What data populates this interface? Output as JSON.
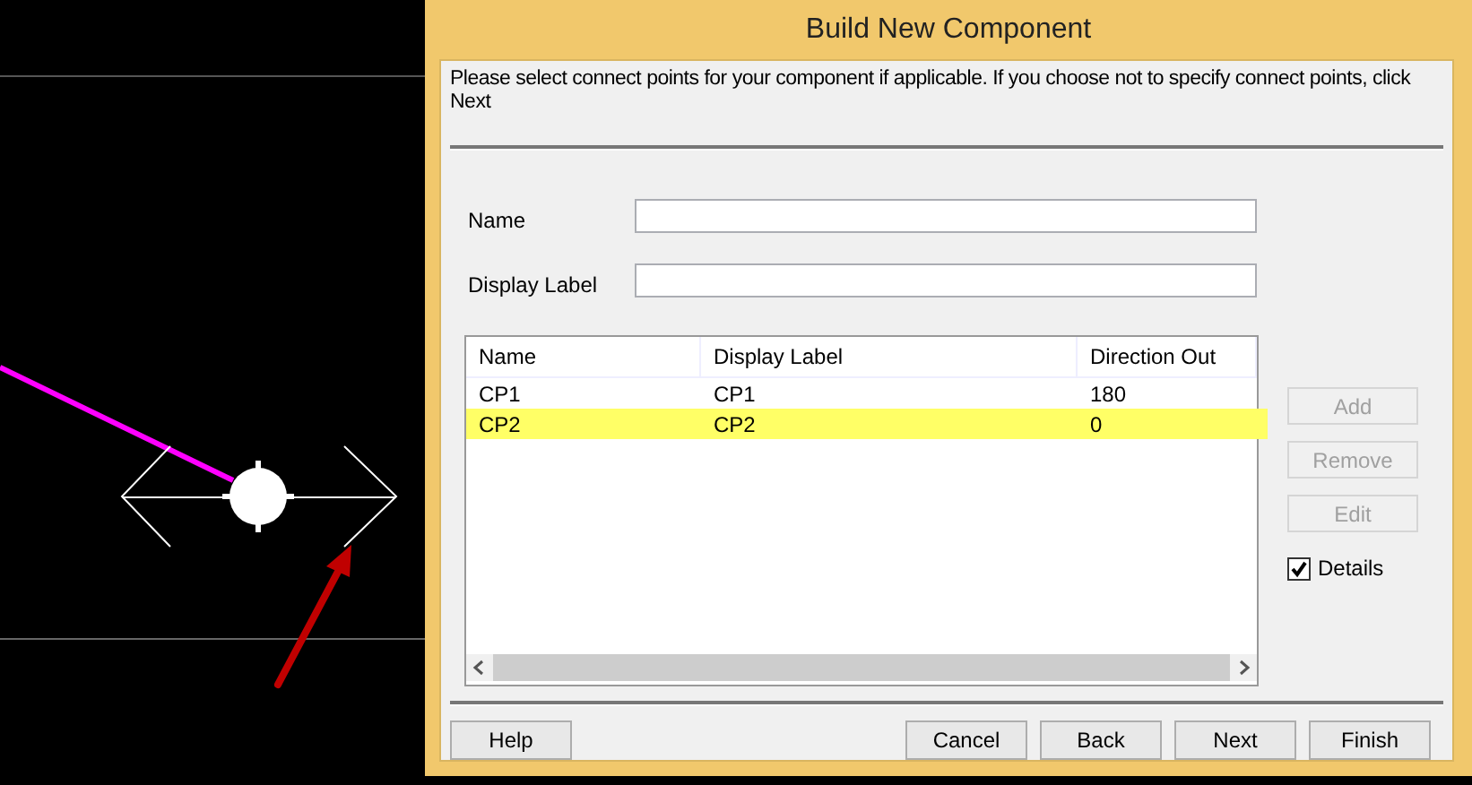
{
  "dialog": {
    "title": "Build New Component",
    "instructions": "Please select connect points for your component if applicable. If you choose not to specify connect points, click Next"
  },
  "fields": [
    {
      "label": "Name"
    },
    {
      "label": "Display Label"
    }
  ],
  "list": {
    "columns": [
      "Name",
      "Display Label",
      "Direction Out"
    ],
    "rows": [
      {
        "cells": [
          "CP1",
          "CP1",
          "180"
        ],
        "selected": false
      },
      {
        "cells": [
          "CP2",
          "CP2",
          "0"
        ],
        "selected": true
      }
    ]
  },
  "side_buttons": [
    {
      "label": "Add",
      "disabled": true
    },
    {
      "label": "Remove",
      "disabled": true
    },
    {
      "label": "Edit",
      "disabled": true
    }
  ],
  "details": {
    "label": "Details",
    "checked": true
  },
  "footer_buttons": {
    "left": [
      "Help"
    ],
    "right": [
      "Cancel",
      "Back",
      "Next",
      "Finish"
    ]
  }
}
